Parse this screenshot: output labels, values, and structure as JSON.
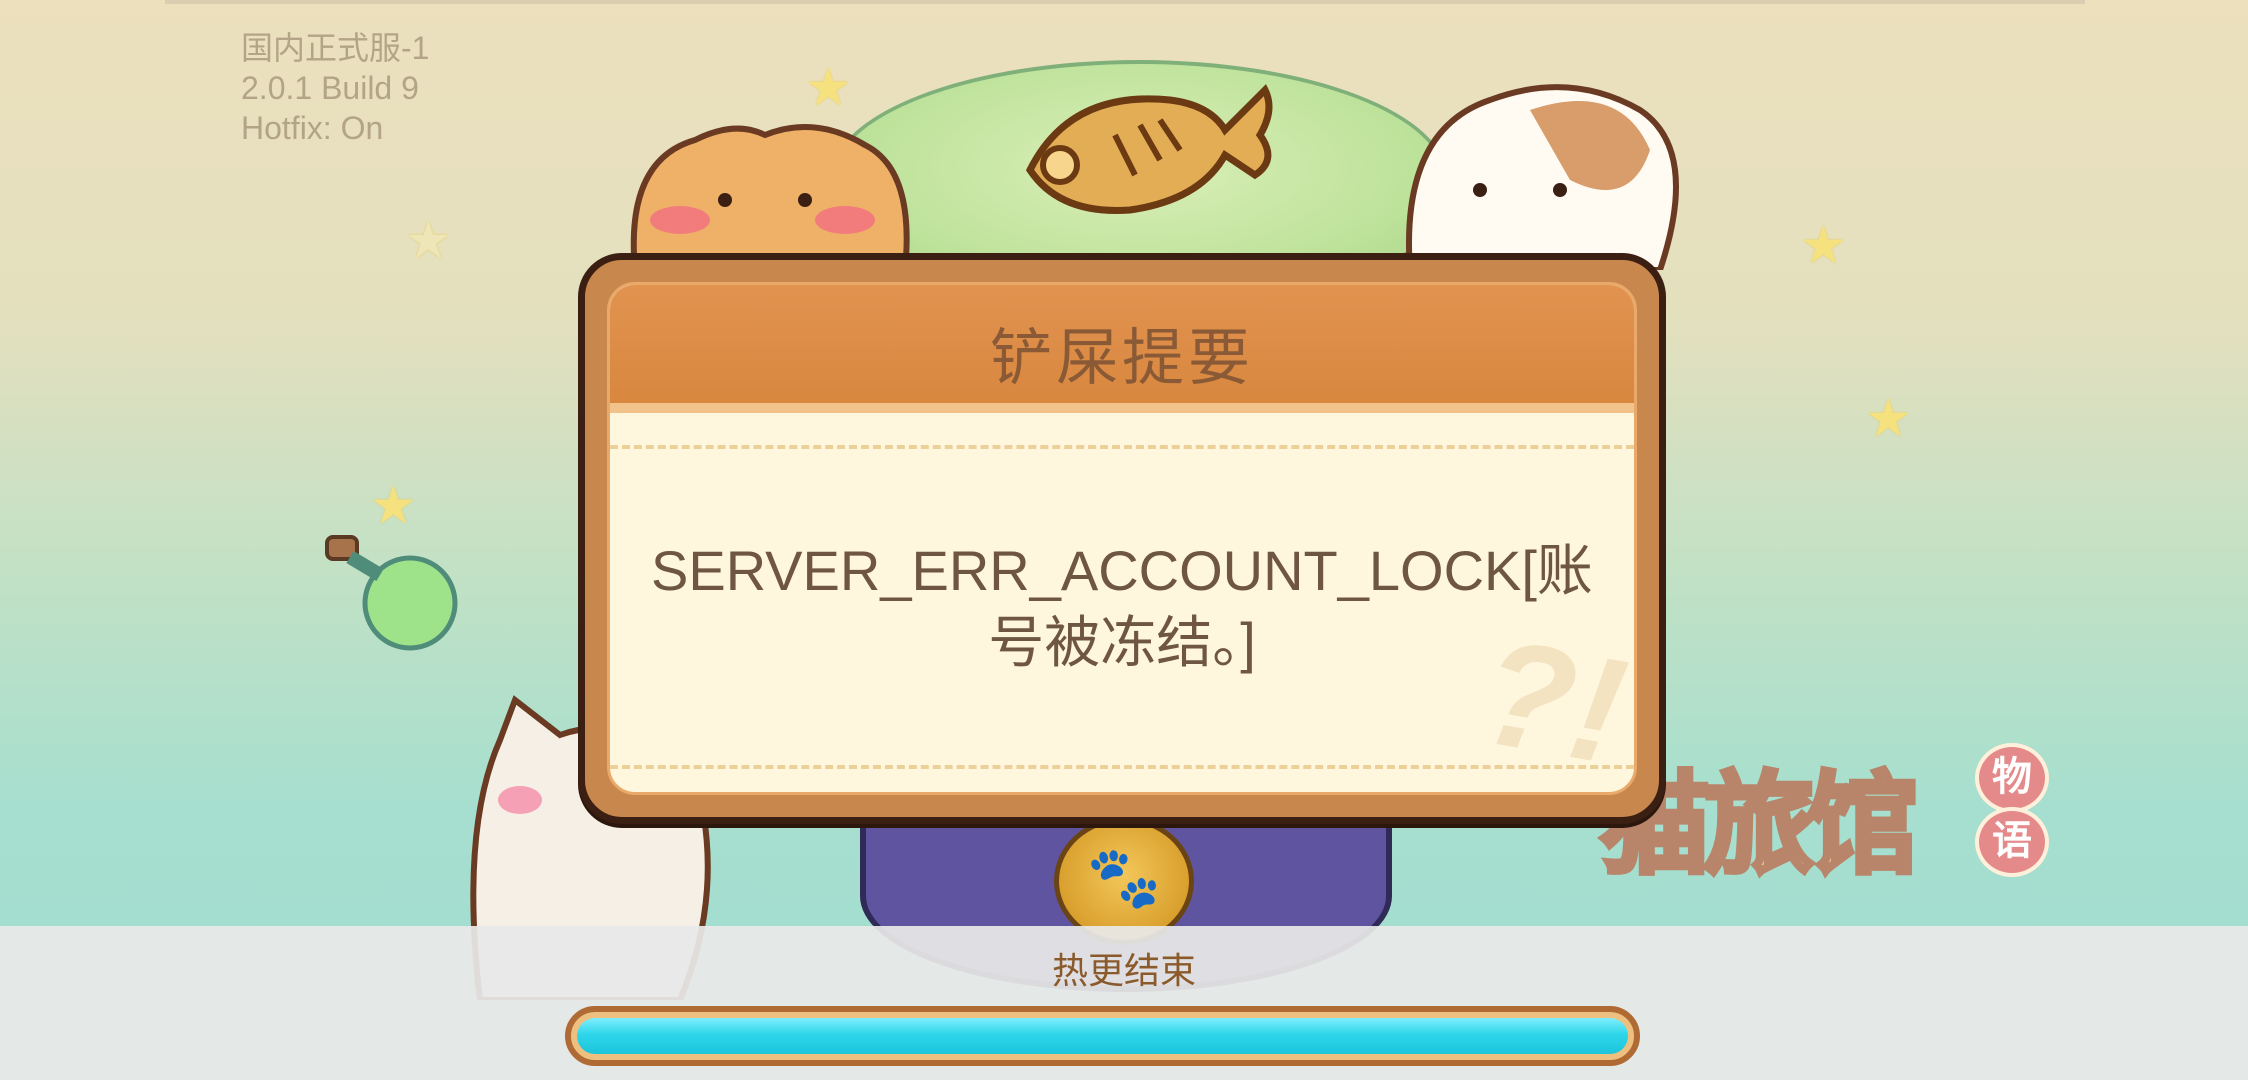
{
  "version_info": {
    "server": "国内正式服-1",
    "build": "2.0.1 Build 9",
    "hotfix": "Hotfix: On"
  },
  "dialog": {
    "title": "铲屎提要",
    "message": "SERVER_ERR_ACCOUNT_LOCK[账号被冻结。]"
  },
  "logo": {
    "text": "猫旅馆",
    "badge_top": "物",
    "badge_bottom": "语"
  },
  "loading": {
    "status": "热更结束",
    "progress": 1.0
  },
  "colors": {
    "dialog_frame": "#c8874c",
    "header": "#d9873f",
    "progress_fill": "#2fd6ea"
  }
}
